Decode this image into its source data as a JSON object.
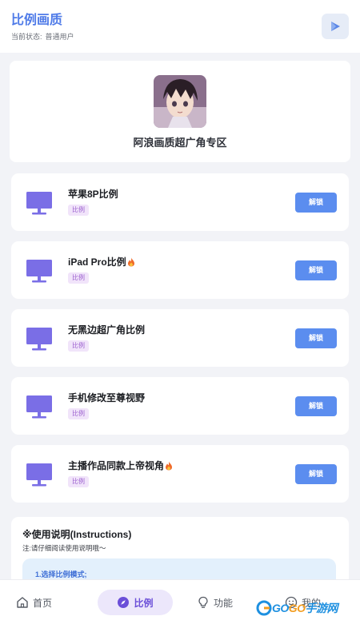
{
  "header": {
    "title": "比例画质",
    "status_label": "当前状态:",
    "status_value": "普通用户",
    "play_icon": "play-icon"
  },
  "profile": {
    "zone_title": "阿浪画质超广角专区",
    "avatar_icon": "anime-avatar"
  },
  "colors": {
    "accent": "#4f7be8",
    "button": "#5b8def",
    "monitor": "#7a6ee6",
    "tag_bg": "#f1e4fa",
    "tag_text": "#9b5fcf"
  },
  "ratios": [
    {
      "name": "苹果8P比例",
      "tag": "比例",
      "button": "解锁",
      "hot": false
    },
    {
      "name": "iPad Pro比例",
      "tag": "比例",
      "button": "解锁",
      "hot": true
    },
    {
      "name": "无黑边超广角比例",
      "tag": "比例",
      "button": "解锁",
      "hot": false
    },
    {
      "name": "手机修改至尊视野",
      "tag": "比例",
      "button": "解锁",
      "hot": false
    },
    {
      "name": "主播作品同款上帝视角",
      "tag": "比例",
      "button": "解锁",
      "hot": true
    }
  ],
  "instructions": {
    "title": "※使用说明(Instructions)",
    "note": "注:请仔细阅读使用说明哦～",
    "step1": "1.选择比例模式;"
  },
  "nav": {
    "home": "首页",
    "ratio": "比例",
    "features": "功能",
    "mine": "我的"
  },
  "watermark": {
    "brand_a": "GO",
    "brand_b": "GO",
    "brand_c": "手游网",
    "url": "www.gogo.cn"
  }
}
